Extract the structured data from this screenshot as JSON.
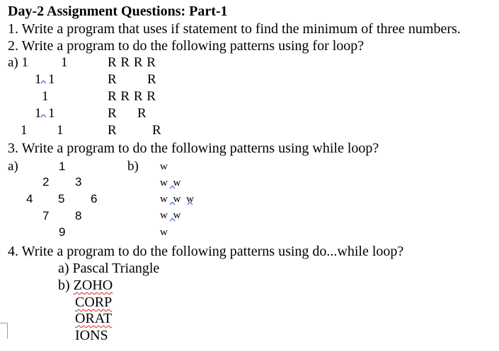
{
  "title": "Day-2 Assignment Questions: Part-1",
  "questions": {
    "q1": "1. Write a program that uses if statement to find the minimum of three numbers.",
    "q2": "2. Write a program to do the following patterns using for loop?",
    "q3": "3. Write a program to do the following patterns using while loop?",
    "q4": "4. Write a program to do the following patterns using do...while loop?"
  },
  "q2_patterns": {
    "a_label": "a) 1",
    "one_pattern": [
      "1",
      "1",
      "1",
      "1",
      "1",
      "1",
      "1",
      "1",
      "1"
    ],
    "r_pattern": [
      "R R R R",
      "R",
      "R",
      "R R R R",
      "R",
      "R",
      "R",
      "R"
    ]
  },
  "q3_patterns": {
    "a_label": "a)",
    "b_label": "b)",
    "numbers": [
      "1",
      "2",
      "3",
      "4",
      "5",
      "6",
      "7",
      "8",
      "9"
    ],
    "w_rows": [
      "w",
      "w w",
      "w w w",
      "w w",
      "w"
    ]
  },
  "q4_patterns": {
    "a": "a) Pascal Triangle",
    "b_prefix": "b) ",
    "b_word": "ZOHO",
    "words": [
      "CORP",
      "ORAT",
      "IONS"
    ]
  },
  "colors": {
    "text": "#000000",
    "spellcheck": "#e02020"
  }
}
